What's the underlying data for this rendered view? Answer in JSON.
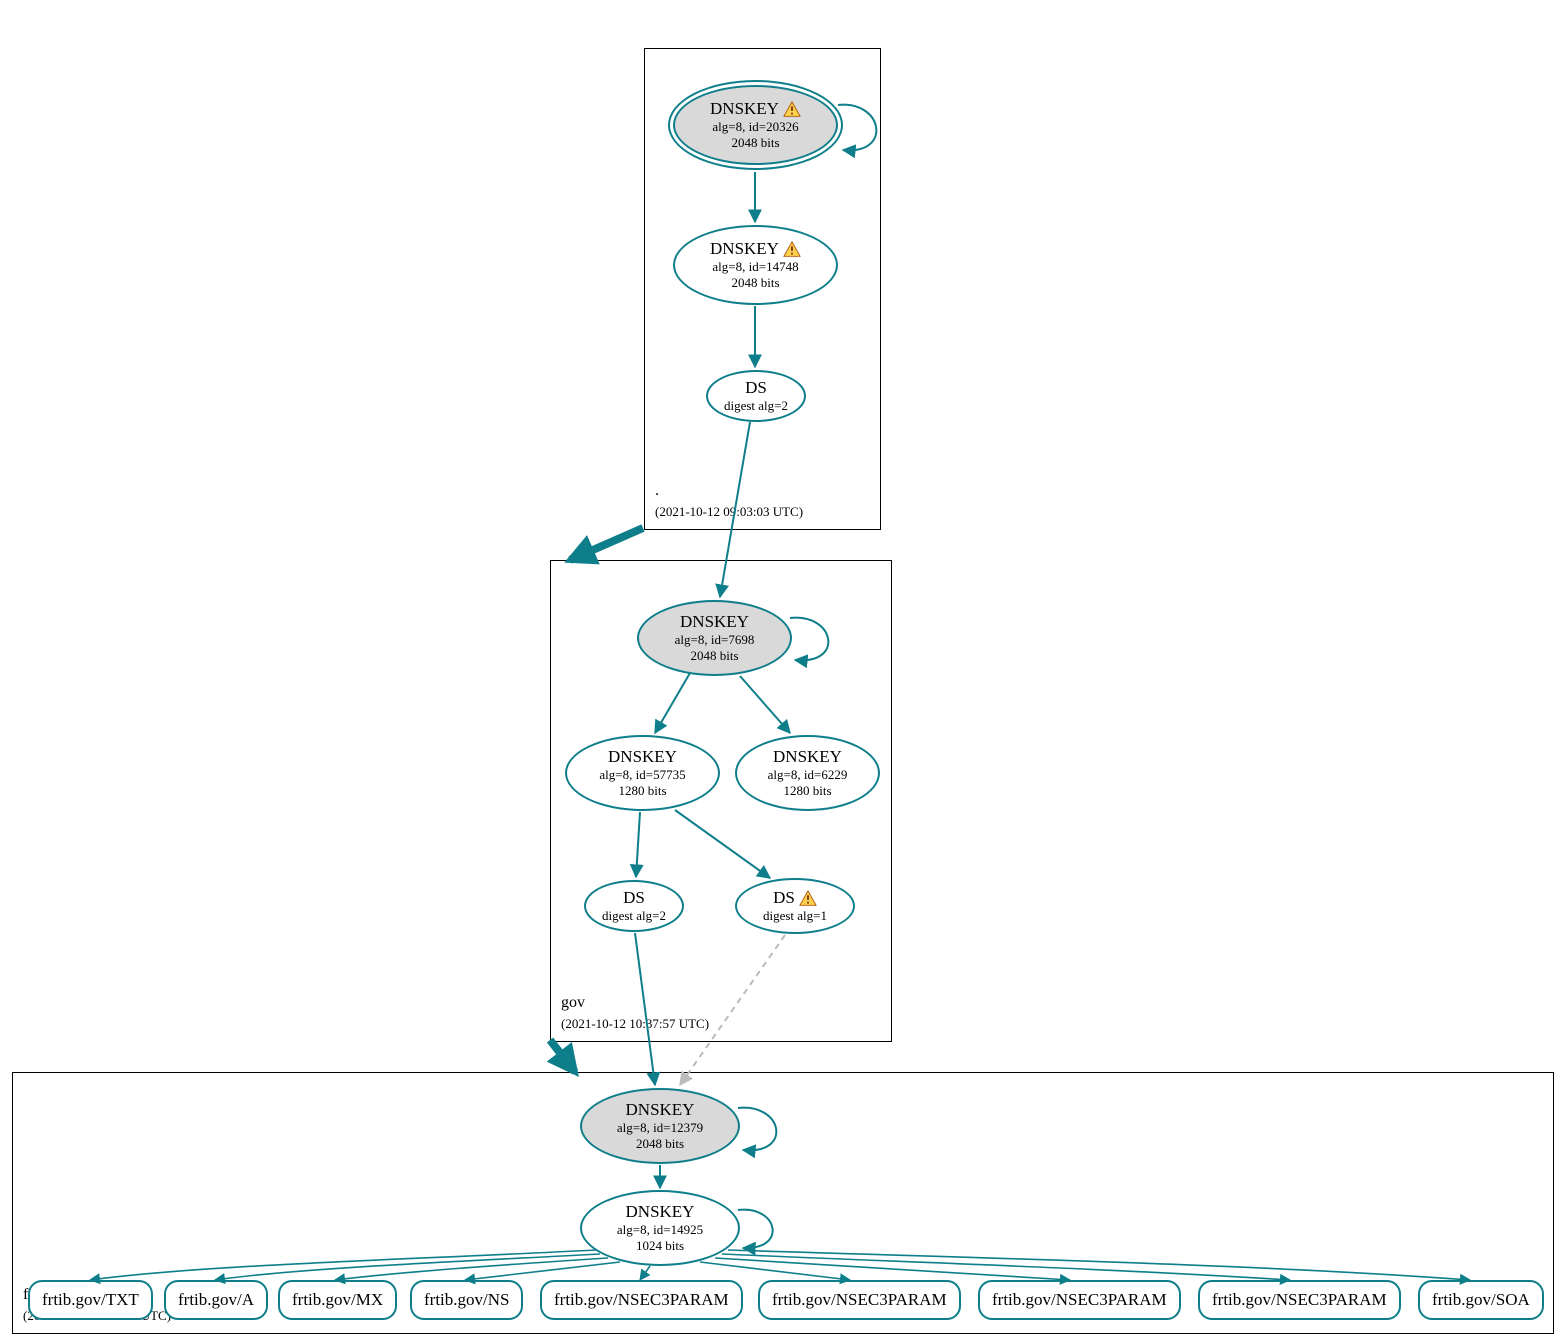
{
  "zones": {
    "root": {
      "label": ".",
      "timestamp": "(2021-10-12 09:03:03 UTC)"
    },
    "gov": {
      "label": "gov",
      "timestamp": "(2021-10-12 10:37:57 UTC)"
    },
    "frtib": {
      "label": "frtib.gov",
      "timestamp": "(2021-10-12 14:02:13 UTC)"
    }
  },
  "nodes": {
    "root_ksk": {
      "title": "DNSKEY",
      "sub1": "alg=8, id=20326",
      "sub2": "2048 bits",
      "warn": true
    },
    "root_zsk": {
      "title": "DNSKEY",
      "sub1": "alg=8, id=14748",
      "sub2": "2048 bits",
      "warn": true
    },
    "root_ds": {
      "title": "DS",
      "sub1": "digest alg=2"
    },
    "gov_ksk": {
      "title": "DNSKEY",
      "sub1": "alg=8, id=7698",
      "sub2": "2048 bits"
    },
    "gov_zsk1": {
      "title": "DNSKEY",
      "sub1": "alg=8, id=57735",
      "sub2": "1280 bits"
    },
    "gov_zsk2": {
      "title": "DNSKEY",
      "sub1": "alg=8, id=6229",
      "sub2": "1280 bits"
    },
    "gov_ds2": {
      "title": "DS",
      "sub1": "digest alg=2"
    },
    "gov_ds1": {
      "title": "DS",
      "sub1": "digest alg=1",
      "warn": true
    },
    "frtib_ksk": {
      "title": "DNSKEY",
      "sub1": "alg=8, id=12379",
      "sub2": "2048 bits"
    },
    "frtib_zsk": {
      "title": "DNSKEY",
      "sub1": "alg=8, id=14925",
      "sub2": "1024 bits"
    }
  },
  "rr": {
    "txt": "frtib.gov/TXT",
    "a": "frtib.gov/A",
    "mx": "frtib.gov/MX",
    "ns": "frtib.gov/NS",
    "n3p1": "frtib.gov/NSEC3PARAM",
    "n3p2": "frtib.gov/NSEC3PARAM",
    "n3p3": "frtib.gov/NSEC3PARAM",
    "n3p4": "frtib.gov/NSEC3PARAM",
    "soa": "frtib.gov/SOA"
  }
}
